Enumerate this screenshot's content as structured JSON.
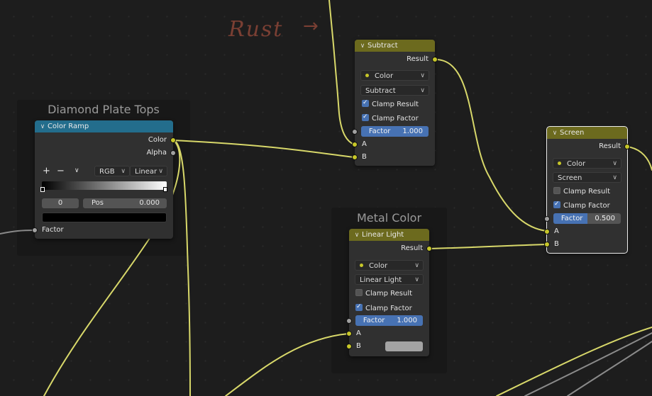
{
  "annotation": {
    "text": "Rust",
    "arrow": "→",
    "color": "#7a3f33"
  },
  "colors": {
    "wire": "#d8d86a",
    "wire_gray": "#8a8a8a",
    "header_yellow": "#6c6a1e",
    "header_blue": "#236d8c",
    "slider_blue": "#4772b3",
    "socket_yellow": "#c7c729",
    "socket_gray": "#a1a1a1"
  },
  "frames": {
    "diamond": {
      "title": "Diamond Plate Tops"
    },
    "metal": {
      "title": "Metal Color"
    }
  },
  "color_ramp": {
    "title": "Color Ramp",
    "outputs": [
      "Color",
      "Alpha"
    ],
    "add_icon": "+",
    "remove_icon": "−",
    "menu_icon": "chevron-down-icon",
    "color_mode": "RGB",
    "interpolation": "Linear",
    "stop_index": "0",
    "pos_label": "Pos",
    "pos_value": "0.000",
    "input": "Factor"
  },
  "subtract": {
    "title": "Subtract",
    "output": "Result",
    "data_type": "Color",
    "blend_mode": "Subtract",
    "clamp_result_label": "Clamp Result",
    "clamp_result": true,
    "clamp_factor_label": "Clamp Factor",
    "clamp_factor": true,
    "factor_label": "Factor",
    "factor_value": "1.000",
    "factor_fraction": 1.0,
    "inputs": [
      "A",
      "B"
    ]
  },
  "screen": {
    "title": "Screen",
    "output": "Result",
    "data_type": "Color",
    "blend_mode": "Screen",
    "clamp_result_label": "Clamp Result",
    "clamp_result": false,
    "clamp_factor_label": "Clamp Factor",
    "clamp_factor": true,
    "factor_label": "Factor",
    "factor_value": "0.500",
    "factor_fraction": 0.5,
    "inputs": [
      "A",
      "B"
    ]
  },
  "linear_light": {
    "title": "Linear Light",
    "output": "Result",
    "data_type": "Color",
    "blend_mode": "Linear Light",
    "clamp_result_label": "Clamp Result",
    "clamp_result": false,
    "clamp_factor_label": "Clamp Factor",
    "clamp_factor": true,
    "factor_label": "Factor",
    "factor_value": "1.000",
    "factor_fraction": 1.0,
    "inputs": [
      "A",
      "B"
    ],
    "b_color": "#a3a3a3"
  }
}
